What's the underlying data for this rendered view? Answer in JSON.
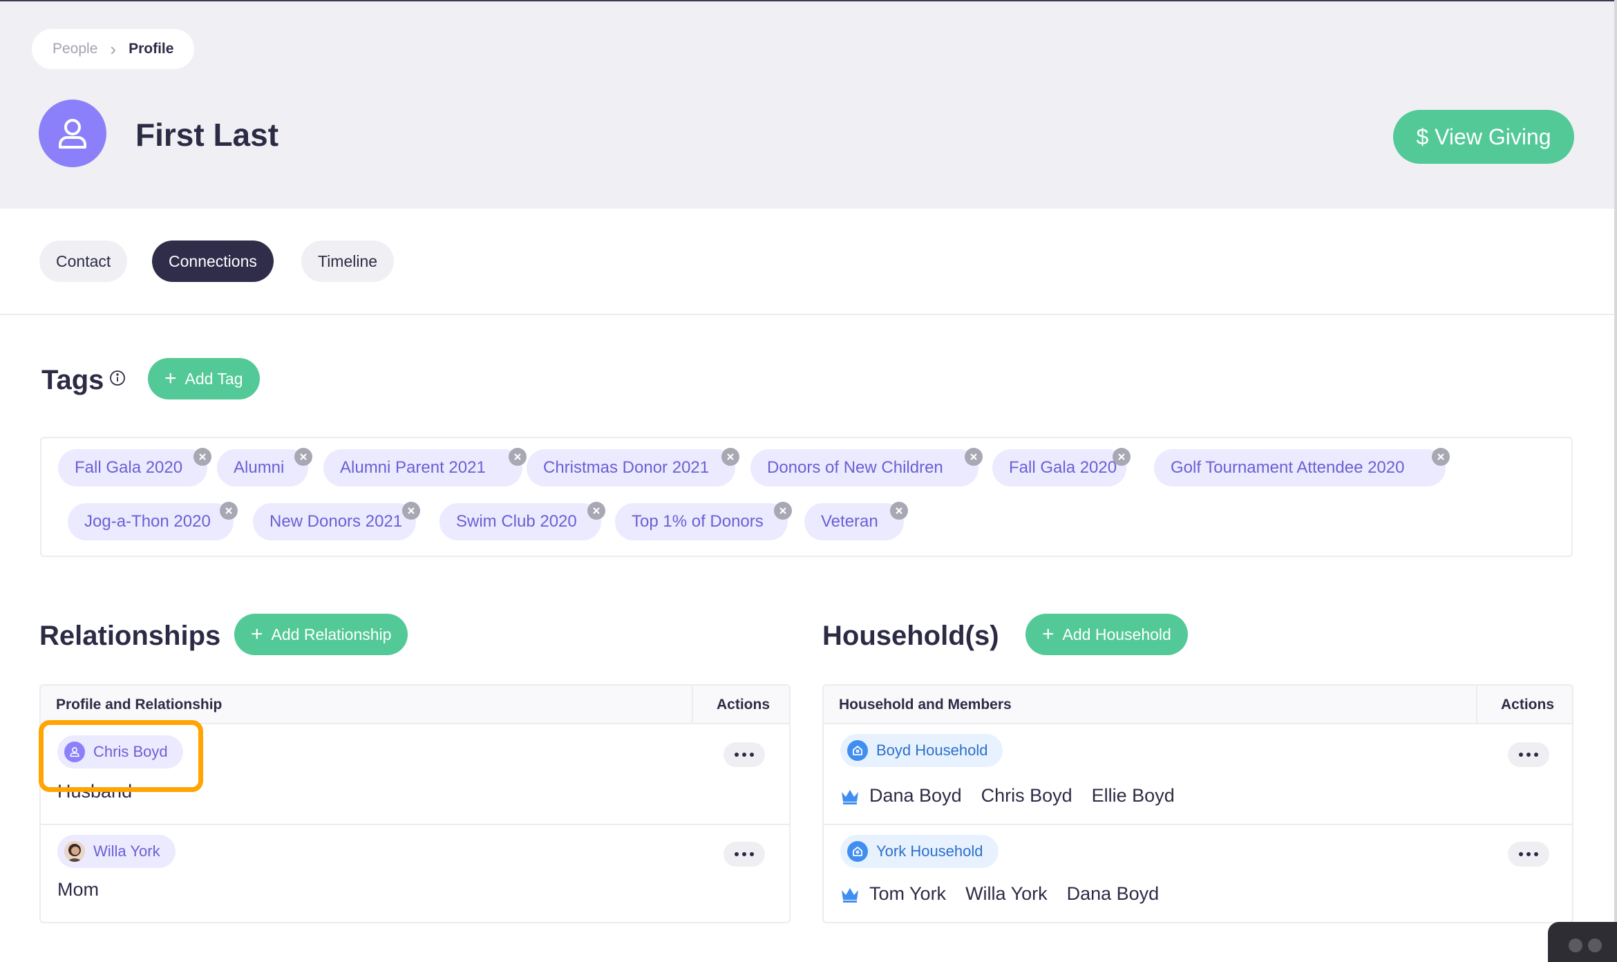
{
  "breadcrumb": {
    "parent": "People",
    "separator": "›",
    "current": "Profile"
  },
  "profile": {
    "name": "First Last"
  },
  "header": {
    "view_giving_label": "$ View Giving"
  },
  "tabs": [
    {
      "label": "Contact"
    },
    {
      "label": "Connections",
      "active": true
    },
    {
      "label": "Timeline"
    }
  ],
  "tags_section": {
    "title": "Tags",
    "add_label": "Add Tag",
    "tags": [
      "Fall Gala 2020",
      "Alumni",
      "Alumni Parent 2021",
      "Christmas Donor 2021",
      "Donors of New Children",
      "Fall Gala 2020",
      "Golf Tournament Attendee 2020",
      "Jog-a-Thon 2020",
      "New Donors 2021",
      "Swim Club 2020",
      "Top 1% of Donors",
      "Veteran"
    ]
  },
  "relationships": {
    "title": "Relationships",
    "add_label": "Add Relationship",
    "col_profile": "Profile and Relationship",
    "col_actions": "Actions",
    "rows": [
      {
        "name": "Chris Boyd",
        "relationship": "Husband"
      },
      {
        "name": "Willa York",
        "relationship": "Mom"
      }
    ]
  },
  "households": {
    "title": "Household(s)",
    "add_label": "Add Household",
    "col_household": "Household and Members",
    "col_actions": "Actions",
    "rows": [
      {
        "name": "Boyd Household",
        "members": [
          "Dana Boyd",
          "Chris Boyd",
          "Ellie Boyd"
        ]
      },
      {
        "name": "York Household",
        "members": [
          "Tom York",
          "Willa York",
          "Dana Boyd"
        ]
      }
    ]
  },
  "colors": {
    "accent_green": "#52c996",
    "avatar_purple": "#8b80f9",
    "tag_text": "#6a5fd4",
    "household_blue": "#2b6fc9",
    "highlight_orange": "#ffa400"
  }
}
